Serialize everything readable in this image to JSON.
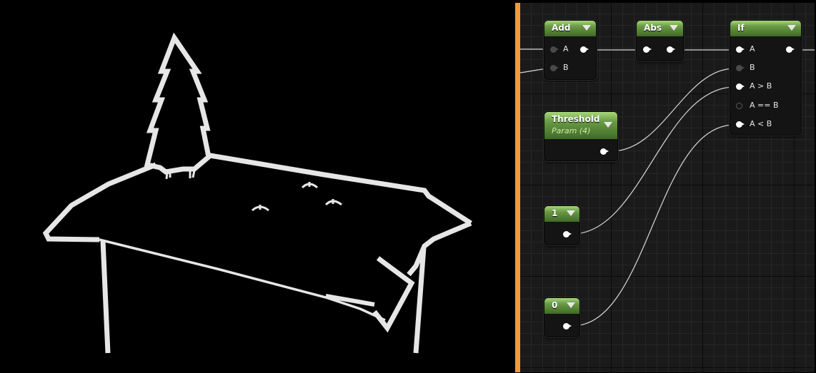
{
  "viewport": {
    "scene": "white-outline render of a table with a pine tree and small objects"
  },
  "graph": {
    "grid_color": "#1a1a1a",
    "accent_divider": "#f39a3b",
    "nodes": {
      "add": {
        "title": "Add",
        "inputs": [
          "A",
          "B"
        ]
      },
      "abs": {
        "title": "Abs"
      },
      "if": {
        "title": "If",
        "inputs": [
          "A",
          "B",
          "A > B",
          "A == B",
          "A < B"
        ]
      },
      "threshold": {
        "title": "Threshold",
        "subtitle": "Param (4)"
      },
      "const1": {
        "title": "1"
      },
      "const0": {
        "title": "0"
      }
    }
  }
}
